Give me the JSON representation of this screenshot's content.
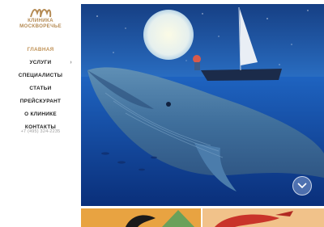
{
  "logo": {
    "line1": "КЛИНИКА",
    "line2": "МОСКВОРЕЧЬЕ"
  },
  "nav": {
    "items": [
      {
        "label": "ГЛАВНАЯ",
        "active": true
      },
      {
        "label": "УСЛУГИ",
        "has_submenu": true
      },
      {
        "label": "СПЕЦИАЛИСТЫ"
      },
      {
        "label": "СТАТЬИ"
      },
      {
        "label": "ПРЕЙСКУРАНТ"
      },
      {
        "label": "О КЛИНИКЕ"
      },
      {
        "label": "КОНТАКТЫ"
      }
    ],
    "submenu_icon": "chevron-right-icon"
  },
  "contact": {
    "phone": "+7 (495) 324-2235"
  },
  "hero": {
    "image": "whale-illustration",
    "scroll_icon": "chevron-down-icon"
  },
  "colors": {
    "accent": "#c09257",
    "text": "#222222",
    "muted": "#9a9a9a",
    "hero_sky": "#1f5fb0",
    "hero_sea": "#0d3f8f"
  }
}
